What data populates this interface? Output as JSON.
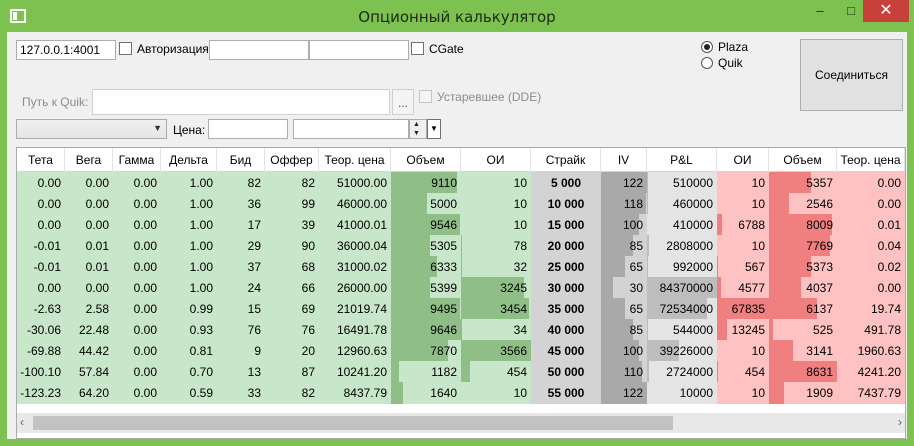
{
  "window": {
    "title": "Опционный калькулятор",
    "min_icon": "minimize-icon",
    "max_icon": "maximize-icon",
    "close_icon": "close-icon"
  },
  "connection": {
    "address_value": "127.0.0.1:4001",
    "auth_label": "Авторизация",
    "login_value": "",
    "password_value": "",
    "cgate_label": "CGate",
    "quik_path_label": "Путь к Quik:",
    "quik_path_value": "",
    "browse_label": "...",
    "legacy_dde_label": "Устаревшее (DDE)",
    "radio_plaza": "Plaza",
    "radio_quik": "Quik",
    "selected_source": "Plaza",
    "connect_label": "Соединиться"
  },
  "filter": {
    "instrument_value": "",
    "price_label": "Цена:",
    "price_value": "",
    "date_value": ""
  },
  "colors": {
    "call_bg": "#c8e6c9",
    "call_bar": "#8fbf87",
    "put_bg": "#ffc2c2",
    "put_bar": "#f07f7f",
    "strike_bg": "#d3d3d3",
    "iv_bar": "#a9a9a9",
    "pl_bg": "#e4e4e4",
    "pl_bar": "#bdbdbd"
  },
  "table": {
    "headers": [
      "Тета",
      "Вега",
      "Гамма",
      "Дельта",
      "Бид",
      "Оффер",
      "Теор. цена",
      "Объем",
      "ОИ",
      "Страйк",
      "IV",
      "P&L",
      "ОИ",
      "Объем",
      "Теор. цена"
    ],
    "rows": [
      [
        "0.00",
        "0.00",
        "0.00",
        "1.00",
        "82",
        "82",
        "51000.00",
        "9110",
        "10",
        "5 000",
        "122",
        "510000",
        "10",
        "5357",
        "0.00"
      ],
      [
        "0.00",
        "0.00",
        "0.00",
        "1.00",
        "36",
        "99",
        "46000.00",
        "5000",
        "10",
        "10 000",
        "118",
        "460000",
        "10",
        "2546",
        "0.00"
      ],
      [
        "0.00",
        "0.00",
        "0.00",
        "1.00",
        "17",
        "39",
        "41000.01",
        "9546",
        "10",
        "15 000",
        "100",
        "410000",
        "6788",
        "8009",
        "0.01"
      ],
      [
        "-0.01",
        "0.01",
        "0.00",
        "1.00",
        "29",
        "90",
        "36000.04",
        "5305",
        "78",
        "20 000",
        "85",
        "2808000",
        "10",
        "7769",
        "0.04"
      ],
      [
        "-0.01",
        "0.01",
        "0.00",
        "1.00",
        "37",
        "68",
        "31000.02",
        "6333",
        "32",
        "25 000",
        "65",
        "992000",
        "567",
        "5373",
        "0.02"
      ],
      [
        "0.00",
        "0.00",
        "0.00",
        "1.00",
        "24",
        "66",
        "26000.00",
        "5399",
        "3245",
        "30 000",
        "30",
        "84370000",
        "4577",
        "4037",
        "0.00"
      ],
      [
        "-2.63",
        "2.58",
        "0.00",
        "0.99",
        "15",
        "69",
        "21019.74",
        "9495",
        "3454",
        "35 000",
        "65",
        "72534000",
        "67835",
        "6137",
        "19.74"
      ],
      [
        "-30.06",
        "22.48",
        "0.00",
        "0.93",
        "76",
        "76",
        "16491.78",
        "9646",
        "34",
        "40 000",
        "85",
        "544000",
        "13245",
        "525",
        "491.78"
      ],
      [
        "-69.88",
        "44.42",
        "0.00",
        "0.81",
        "9",
        "20",
        "12960.63",
        "7870",
        "3566",
        "45 000",
        "100",
        "39226000",
        "10",
        "3141",
        "1960.63"
      ],
      [
        "-100.10",
        "57.84",
        "0.00",
        "0.70",
        "13",
        "87",
        "10241.20",
        "1182",
        "454",
        "50 000",
        "110",
        "2724000",
        "454",
        "8631",
        "4241.20"
      ],
      [
        "-123.23",
        "64.20",
        "0.00",
        "0.59",
        "33",
        "82",
        "8437.79",
        "1640",
        "10",
        "55 000",
        "122",
        "10000",
        "10",
        "1909",
        "7437.79"
      ]
    ],
    "call_volume_fill": [
      0.94,
      0.52,
      0.99,
      0.55,
      0.66,
      0.56,
      0.98,
      1.0,
      0.82,
      0.12,
      0.17
    ],
    "call_oi_fill": [
      0.0,
      0.0,
      0.0,
      0.02,
      0.01,
      0.9,
      0.97,
      0.01,
      1.0,
      0.13,
      0.0
    ],
    "iv_fill": [
      1.0,
      0.97,
      0.82,
      0.7,
      0.53,
      0.25,
      0.53,
      0.7,
      0.82,
      0.9,
      1.0
    ],
    "pl_fill": [
      0.01,
      0.01,
      0.0,
      0.03,
      0.01,
      1.0,
      0.86,
      0.01,
      0.46,
      0.03,
      0.0
    ],
    "put_oi_fill": [
      0.0,
      0.0,
      0.1,
      0.0,
      0.01,
      0.07,
      1.0,
      0.2,
      0.0,
      0.01,
      0.0
    ],
    "put_volume_fill": [
      0.62,
      0.3,
      0.93,
      0.9,
      0.62,
      0.47,
      0.71,
      0.06,
      0.36,
      1.0,
      0.22
    ]
  }
}
